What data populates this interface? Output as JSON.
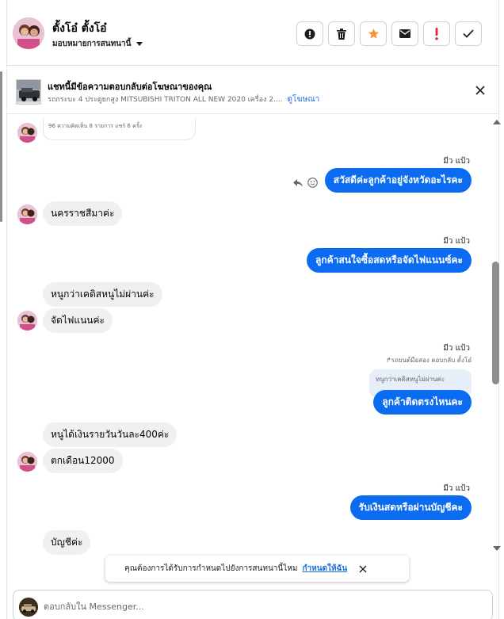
{
  "header": {
    "contact_name": "ตั้งโอ๋ ตั้งโอ๋",
    "assign_label": "มอบหมายการสนทนานี้",
    "actions": [
      {
        "name": "spam-report-button",
        "icon": "alert-circle-icon"
      },
      {
        "name": "delete-button",
        "icon": "trash-icon"
      },
      {
        "name": "star-button",
        "icon": "star-icon"
      },
      {
        "name": "mark-unread-button",
        "icon": "envelope-icon"
      },
      {
        "name": "follow-up-button",
        "icon": "exclamation-icon"
      },
      {
        "name": "mark-done-button",
        "icon": "check-icon"
      }
    ]
  },
  "ad_banner": {
    "title": "แชทนี้มีข้อความตอบกลับต่อโฆษณาของคุณ",
    "subtitle": "รถกระบะ 4 ประตูยกสูง MITSUBISHI TRITON ALL NEW 2020 เครื่อง 2....",
    "link_label": "ดูโฆษณา"
  },
  "card_preview": {
    "text": "96     ความคิดเห็น 8 รายการ  แชร์ 6 ครั้ง"
  },
  "messages": [
    {
      "sender": "มีว แป้ว",
      "text": "สวัสดีค่ะลูกค้าอยู่จังหวัดอะไรคะ"
    },
    {
      "text": "นครราชสีมาค่ะ"
    },
    {
      "sender": "มีว แป้ว",
      "text": "ลูกค้าสนใจซื้อสดหรือจัดไฟแนนซ์คะ"
    },
    {
      "text": "หนูกว่าเคดิสหนูไม่ผ่านค่ะ"
    },
    {
      "text": "จัดไฟแนนค่ะ"
    },
    {
      "sender": "มีว แป้ว",
      "reply_meta": "รถยนต์มือสอง ตอบกลับ ตั้งโอ๋",
      "quote": "หนูกว่าเคดิสหนูไม่ผ่านค่ะ",
      "text": "ลูกค้าติดตรงไหนคะ"
    },
    {
      "text": "หนูได้เงินรายวันวันละ400ค่ะ"
    },
    {
      "text": "ตกเดือน12000"
    },
    {
      "sender": "มีว แป้ว",
      "text": "รับเงินสดหรือผ่านบัญชีคะ"
    },
    {
      "text": "บัญชีค่ะ"
    }
  ],
  "toast": {
    "text": "คุณต้องการได้รับการกำหนดไปยังการสนทนานี้ไหม",
    "link_label": "กำหนดให้ฉัน"
  },
  "composer": {
    "placeholder": "ตอบกลับใน Messenger..."
  },
  "colors": {
    "outgoing_bubble": "#0b6cf2",
    "incoming_bubble": "#f0f0f0",
    "star": "#f7923b",
    "follow_up": "#e41e3f",
    "link": "#216fdb"
  }
}
